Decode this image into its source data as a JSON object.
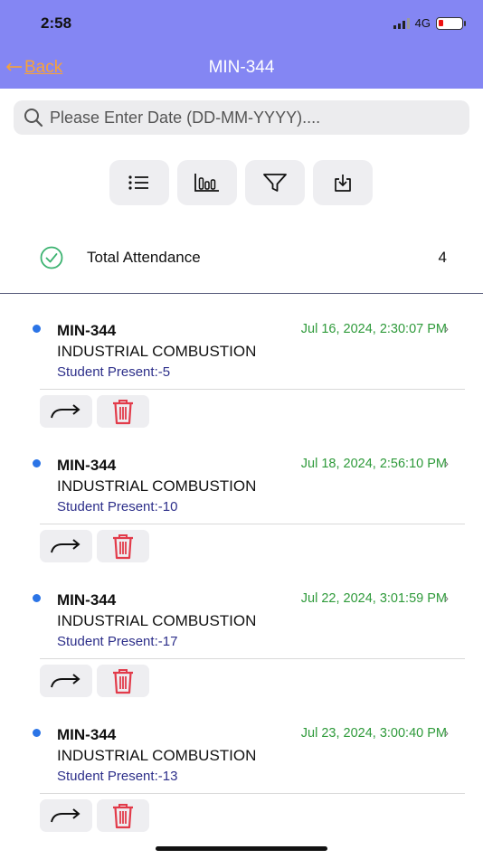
{
  "status_bar": {
    "time": "2:58",
    "network": "4G"
  },
  "header": {
    "back_label": "Back",
    "title": "MIN-344"
  },
  "search": {
    "placeholder": "Please Enter Date (DD-MM-YYYY)...."
  },
  "toolbar": {
    "icons": [
      "list-icon",
      "bar-chart-icon",
      "filter-icon",
      "download-icon"
    ]
  },
  "summary": {
    "label": "Total Attendance",
    "count": "4"
  },
  "records": [
    {
      "code": "MIN-344",
      "date": "Jul 16, 2024, 2:30:07 PM",
      "subject": "INDUSTRIAL COMBUSTION",
      "present": "Student Present:-5"
    },
    {
      "code": "MIN-344",
      "date": "Jul 18, 2024, 2:56:10 PM",
      "subject": "INDUSTRIAL COMBUSTION",
      "present": "Student Present:-10"
    },
    {
      "code": "MIN-344",
      "date": "Jul 22, 2024, 3:01:59 PM",
      "subject": "INDUSTRIAL COMBUSTION",
      "present": "Student Present:-17"
    },
    {
      "code": "MIN-344",
      "date": "Jul 23, 2024, 3:00:40 PM",
      "subject": "INDUSTRIAL COMBUSTION",
      "present": "Student Present:-13"
    }
  ],
  "colors": {
    "header_bg": "#8486f3",
    "back_link": "#f7a23a",
    "date_text": "#2e9a3a",
    "present_text": "#2d2f8a",
    "dot": "#2b74e6",
    "trash": "#e23b4a",
    "check": "#3cb371"
  }
}
